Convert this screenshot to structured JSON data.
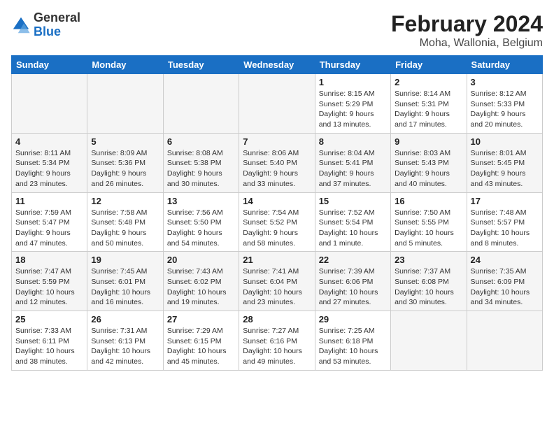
{
  "logo": {
    "text_general": "General",
    "text_blue": "Blue"
  },
  "title": "February 2024",
  "subtitle": "Moha, Wallonia, Belgium",
  "days_of_week": [
    "Sunday",
    "Monday",
    "Tuesday",
    "Wednesday",
    "Thursday",
    "Friday",
    "Saturday"
  ],
  "weeks": [
    [
      {
        "day": "",
        "info": ""
      },
      {
        "day": "",
        "info": ""
      },
      {
        "day": "",
        "info": ""
      },
      {
        "day": "",
        "info": ""
      },
      {
        "day": "1",
        "info": "Sunrise: 8:15 AM\nSunset: 5:29 PM\nDaylight: 9 hours\nand 13 minutes."
      },
      {
        "day": "2",
        "info": "Sunrise: 8:14 AM\nSunset: 5:31 PM\nDaylight: 9 hours\nand 17 minutes."
      },
      {
        "day": "3",
        "info": "Sunrise: 8:12 AM\nSunset: 5:33 PM\nDaylight: 9 hours\nand 20 minutes."
      }
    ],
    [
      {
        "day": "4",
        "info": "Sunrise: 8:11 AM\nSunset: 5:34 PM\nDaylight: 9 hours\nand 23 minutes."
      },
      {
        "day": "5",
        "info": "Sunrise: 8:09 AM\nSunset: 5:36 PM\nDaylight: 9 hours\nand 26 minutes."
      },
      {
        "day": "6",
        "info": "Sunrise: 8:08 AM\nSunset: 5:38 PM\nDaylight: 9 hours\nand 30 minutes."
      },
      {
        "day": "7",
        "info": "Sunrise: 8:06 AM\nSunset: 5:40 PM\nDaylight: 9 hours\nand 33 minutes."
      },
      {
        "day": "8",
        "info": "Sunrise: 8:04 AM\nSunset: 5:41 PM\nDaylight: 9 hours\nand 37 minutes."
      },
      {
        "day": "9",
        "info": "Sunrise: 8:03 AM\nSunset: 5:43 PM\nDaylight: 9 hours\nand 40 minutes."
      },
      {
        "day": "10",
        "info": "Sunrise: 8:01 AM\nSunset: 5:45 PM\nDaylight: 9 hours\nand 43 minutes."
      }
    ],
    [
      {
        "day": "11",
        "info": "Sunrise: 7:59 AM\nSunset: 5:47 PM\nDaylight: 9 hours\nand 47 minutes."
      },
      {
        "day": "12",
        "info": "Sunrise: 7:58 AM\nSunset: 5:48 PM\nDaylight: 9 hours\nand 50 minutes."
      },
      {
        "day": "13",
        "info": "Sunrise: 7:56 AM\nSunset: 5:50 PM\nDaylight: 9 hours\nand 54 minutes."
      },
      {
        "day": "14",
        "info": "Sunrise: 7:54 AM\nSunset: 5:52 PM\nDaylight: 9 hours\nand 58 minutes."
      },
      {
        "day": "15",
        "info": "Sunrise: 7:52 AM\nSunset: 5:54 PM\nDaylight: 10 hours\nand 1 minute."
      },
      {
        "day": "16",
        "info": "Sunrise: 7:50 AM\nSunset: 5:55 PM\nDaylight: 10 hours\nand 5 minutes."
      },
      {
        "day": "17",
        "info": "Sunrise: 7:48 AM\nSunset: 5:57 PM\nDaylight: 10 hours\nand 8 minutes."
      }
    ],
    [
      {
        "day": "18",
        "info": "Sunrise: 7:47 AM\nSunset: 5:59 PM\nDaylight: 10 hours\nand 12 minutes."
      },
      {
        "day": "19",
        "info": "Sunrise: 7:45 AM\nSunset: 6:01 PM\nDaylight: 10 hours\nand 16 minutes."
      },
      {
        "day": "20",
        "info": "Sunrise: 7:43 AM\nSunset: 6:02 PM\nDaylight: 10 hours\nand 19 minutes."
      },
      {
        "day": "21",
        "info": "Sunrise: 7:41 AM\nSunset: 6:04 PM\nDaylight: 10 hours\nand 23 minutes."
      },
      {
        "day": "22",
        "info": "Sunrise: 7:39 AM\nSunset: 6:06 PM\nDaylight: 10 hours\nand 27 minutes."
      },
      {
        "day": "23",
        "info": "Sunrise: 7:37 AM\nSunset: 6:08 PM\nDaylight: 10 hours\nand 30 minutes."
      },
      {
        "day": "24",
        "info": "Sunrise: 7:35 AM\nSunset: 6:09 PM\nDaylight: 10 hours\nand 34 minutes."
      }
    ],
    [
      {
        "day": "25",
        "info": "Sunrise: 7:33 AM\nSunset: 6:11 PM\nDaylight: 10 hours\nand 38 minutes."
      },
      {
        "day": "26",
        "info": "Sunrise: 7:31 AM\nSunset: 6:13 PM\nDaylight: 10 hours\nand 42 minutes."
      },
      {
        "day": "27",
        "info": "Sunrise: 7:29 AM\nSunset: 6:15 PM\nDaylight: 10 hours\nand 45 minutes."
      },
      {
        "day": "28",
        "info": "Sunrise: 7:27 AM\nSunset: 6:16 PM\nDaylight: 10 hours\nand 49 minutes."
      },
      {
        "day": "29",
        "info": "Sunrise: 7:25 AM\nSunset: 6:18 PM\nDaylight: 10 hours\nand 53 minutes."
      },
      {
        "day": "",
        "info": ""
      },
      {
        "day": "",
        "info": ""
      }
    ]
  ]
}
